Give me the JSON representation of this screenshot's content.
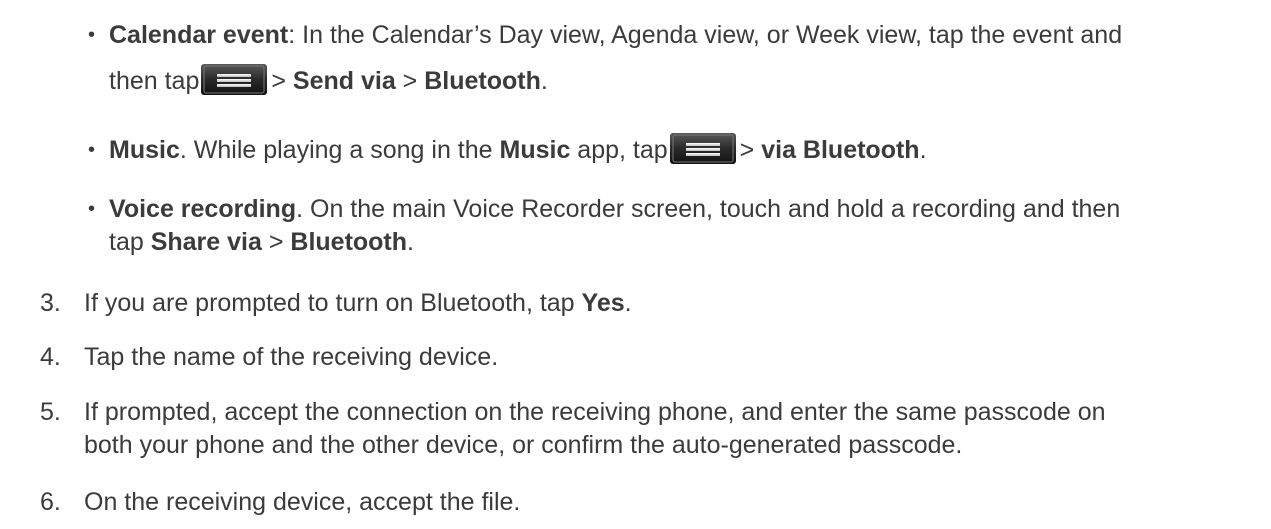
{
  "bullets": [
    {
      "term": "Calendar event",
      "sep": ":",
      "text1": " In the Calendar’s Day view, Agenda view, or Week view, tap the event and",
      "line2_pre": "then tap",
      "gt1": "> ",
      "bold1": "Send via",
      "gt2": " > ",
      "bold2": "Bluetooth",
      "end": "."
    },
    {
      "term": "Music",
      "sep": ".",
      "text1": " While playing a song in the ",
      "bold_app": "Music",
      "text2": " app, tap",
      "gt1": "> ",
      "bold1": "via Bluetooth",
      "end": "."
    },
    {
      "term": "Voice recording",
      "sep": ".",
      "text1": " On the main Voice Recorder screen, touch and hold a recording and then",
      "line2_pre": "tap ",
      "bold1": "Share via",
      "gt1": " > ",
      "bold2": "Bluetooth",
      "end": "."
    }
  ],
  "steps": [
    {
      "num": "3.",
      "text_pre": "If you are prompted to turn on Bluetooth, tap ",
      "bold": "Yes",
      "text_post": "."
    },
    {
      "num": "4.",
      "text": "Tap the name of the receiving device."
    },
    {
      "num": "5.",
      "line1": "If prompted, accept the connection on the receiving phone, and enter the same passcode on",
      "line2": "both your phone and the other device, or confirm the auto-generated passcode."
    },
    {
      "num": "6.",
      "text": "On the receiving device, accept the file."
    }
  ],
  "icons": {
    "menu": "menu-key-icon"
  },
  "colors": {
    "text": "#3b3b3b"
  }
}
